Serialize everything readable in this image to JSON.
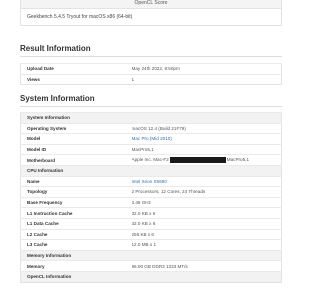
{
  "top": {
    "score_label": "OpenCL Score",
    "version_text": "Geekbench 5.4.5 Tryout for macOS x86 (64-bit)"
  },
  "result_info": {
    "title": "Result Information",
    "rows": [
      {
        "key": "Upload Date",
        "value": "May 24th 2022, 9:50pm"
      },
      {
        "key": "Views",
        "value": "1"
      }
    ]
  },
  "system_info": {
    "title": "System Information",
    "header": "System Information",
    "rows": [
      {
        "key": "Operating System",
        "value": "macOS 12.4 (Build 21F79)"
      },
      {
        "key": "Model",
        "value": "Mac Pro (Mid 2010)"
      },
      {
        "key": "Model ID",
        "value": "MacPro5,1"
      },
      {
        "key": "Motherboard",
        "value_prefix": "Apple Inc. Mac-F2",
        "value_suffix": "MacPro5,1"
      }
    ]
  },
  "cpu_info": {
    "header": "CPU Information",
    "rows": [
      {
        "key": "Name",
        "value": "Intel Xeon X5690"
      },
      {
        "key": "Topology",
        "value": "2 Processors, 12 Cores, 24 Threads"
      },
      {
        "key": "Base Frequency",
        "value": "3.46 GHz"
      },
      {
        "key": "L1 Instruction Cache",
        "value": "32.0 KB x 6"
      },
      {
        "key": "L1 Data Cache",
        "value": "32.0 KB x 6"
      },
      {
        "key": "L2 Cache",
        "value": "256 KB x 6"
      },
      {
        "key": "L3 Cache",
        "value": "12.0 MB x 1"
      }
    ]
  },
  "memory_info": {
    "header": "Memory Information",
    "rows": [
      {
        "key": "Memory",
        "value": "96.00 GB DDR3 1333 MT/s"
      }
    ]
  },
  "opencl_info": {
    "header": "OpenCL Information"
  }
}
